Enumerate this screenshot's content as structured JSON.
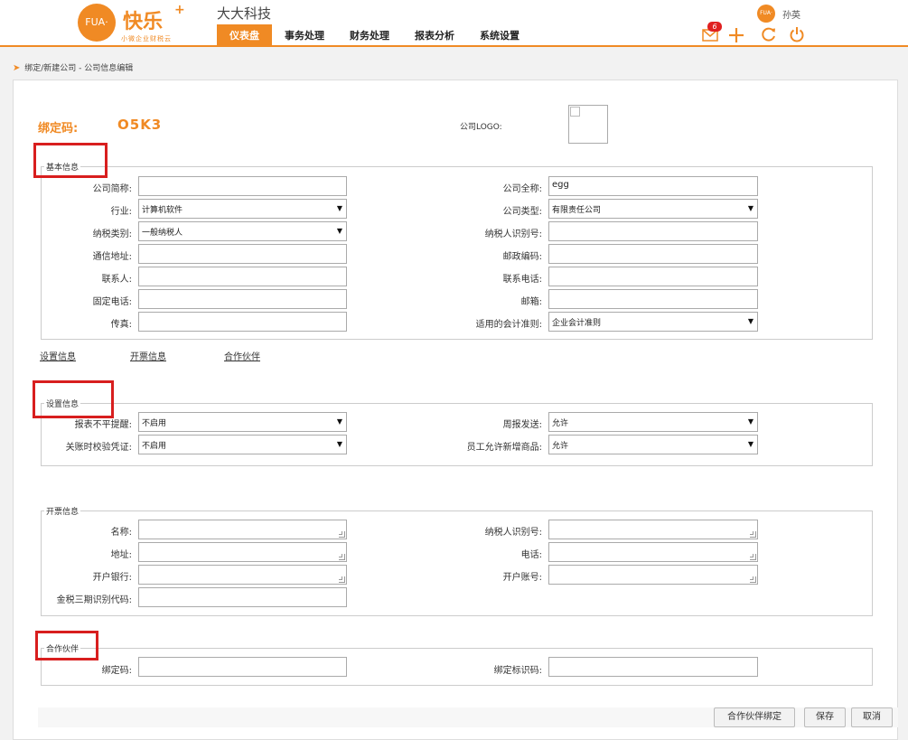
{
  "header": {
    "logo_mark": "FUA·",
    "logo_text": "快乐",
    "logo_plus": "+",
    "logo_sub": "小微企业财税云",
    "company": "大大科技",
    "nav": [
      "仪表盘",
      "事务处理",
      "财务处理",
      "报表分析",
      "系统设置"
    ],
    "nav_active": 0,
    "user_avatar": "FUA·",
    "user_name": "孙英",
    "mail_count": "6",
    "icons": [
      "mail-icon",
      "plus-icon",
      "refresh-icon",
      "power-icon"
    ],
    "accent_color": "#f08a24"
  },
  "breadcrumb": "绑定/新建公司 - 公司信息编辑",
  "bind": {
    "label": "绑定码:",
    "code": "O5K3",
    "logo_label": "公司LOGO:"
  },
  "basic": {
    "legend": "基本信息",
    "fields": {
      "short_name": {
        "label": "公司简称:",
        "value": ""
      },
      "full_name": {
        "label": "公司全称:",
        "value": "egg"
      },
      "industry": {
        "label": "行业:",
        "value": "计算机软件"
      },
      "company_type": {
        "label": "公司类型:",
        "value": "有限责任公司"
      },
      "tax_type": {
        "label": "纳税类别:",
        "value": "一般纳税人"
      },
      "tax_id": {
        "label": "纳税人识别号:",
        "value": ""
      },
      "address": {
        "label": "通信地址:",
        "value": ""
      },
      "postcode": {
        "label": "邮政编码:",
        "value": ""
      },
      "contact": {
        "label": "联系人:",
        "value": ""
      },
      "phone": {
        "label": "联系电话:",
        "value": ""
      },
      "landline": {
        "label": "固定电话:",
        "value": ""
      },
      "email": {
        "label": "邮箱:",
        "value": ""
      },
      "fax": {
        "label": "传真:",
        "value": ""
      },
      "accounting_std": {
        "label": "适用的会计准则:",
        "value": "企业会计准则"
      }
    }
  },
  "section_links": [
    "设置信息",
    "开票信息",
    "合作伙伴"
  ],
  "settings": {
    "legend": "设置信息",
    "report_reminder": {
      "label": "报表不平提醒:",
      "value": "不启用"
    },
    "weekly_report": {
      "label": "周报发送:",
      "value": "允许"
    },
    "closing_check": {
      "label": "关账时校验凭证:",
      "value": "不启用"
    },
    "staff_add_goods": {
      "label": "员工允许新增商品:",
      "value": "允许"
    }
  },
  "invoice": {
    "legend": "开票信息",
    "name": {
      "label": "名称:",
      "value": ""
    },
    "tax_id": {
      "label": "纳税人识别号:",
      "value": ""
    },
    "address": {
      "label": "地址:",
      "value": ""
    },
    "phone": {
      "label": "电话:",
      "value": ""
    },
    "bank": {
      "label": "开户银行:",
      "value": ""
    },
    "account": {
      "label": "开户账号:",
      "value": ""
    },
    "golden_tax_code": {
      "label": "金税三期识别代码:",
      "value": ""
    }
  },
  "partner": {
    "legend": "合作伙伴",
    "bind_code": {
      "label": "绑定码:",
      "value": ""
    },
    "bind_id": {
      "label": "绑定标识码:",
      "value": ""
    }
  },
  "actions": {
    "partner_bind": "合作伙伴绑定",
    "save": "保存",
    "cancel": "取消"
  },
  "highlight_color": "#d81e1e"
}
